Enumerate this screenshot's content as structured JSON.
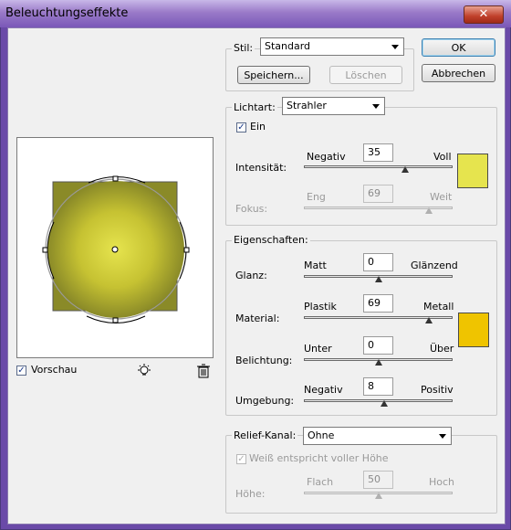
{
  "window": {
    "title": "Beleuchtungseffekte",
    "close_glyph": "✕"
  },
  "buttons": {
    "ok": "OK",
    "cancel": "Abbrechen"
  },
  "stil": {
    "label": "Stil:",
    "value": "Standard",
    "save": "Speichern...",
    "delete": "Löschen"
  },
  "lichtart": {
    "label": "Lichtart:",
    "value": "Strahler",
    "ein_label": "Ein",
    "ein_checked": true,
    "intensitaet": {
      "label": "Intensität:",
      "min_label": "Negativ",
      "max_label": "Voll",
      "value": "35",
      "fraction": 0.68
    },
    "fokus": {
      "label": "Fokus:",
      "min_label": "Eng",
      "max_label": "Weit",
      "value": "69",
      "fraction": 0.84
    },
    "color": "#e6e44e"
  },
  "eigenschaften": {
    "label": "Eigenschaften:",
    "glanz": {
      "label": "Glanz:",
      "min_label": "Matt",
      "max_label": "Glänzend",
      "value": "0",
      "fraction": 0.5
    },
    "material": {
      "label": "Material:",
      "min_label": "Plastik",
      "max_label": "Metall",
      "value": "69",
      "fraction": 0.84
    },
    "belichtung": {
      "label": "Belichtung:",
      "min_label": "Unter",
      "max_label": "Über",
      "value": "0",
      "fraction": 0.5
    },
    "umgebung": {
      "label": "Umgebung:",
      "min_label": "Negativ",
      "max_label": "Positiv",
      "value": "8",
      "fraction": 0.54
    },
    "color": "#efc400"
  },
  "relief": {
    "label": "Relief-Kanal:",
    "value": "Ohne",
    "white_full_label": "Weiß entspricht voller Höhe",
    "hoehe": {
      "label": "Höhe:",
      "min_label": "Flach",
      "max_label": "Hoch",
      "value": "50",
      "fraction": 0.5
    }
  },
  "preview": {
    "label": "Vorschau",
    "checked": true,
    "light_icon": "light-bulb-icon",
    "trash_icon": "trash-icon",
    "light_color": "#e8e84a",
    "surface_color": "#8a8a28"
  }
}
